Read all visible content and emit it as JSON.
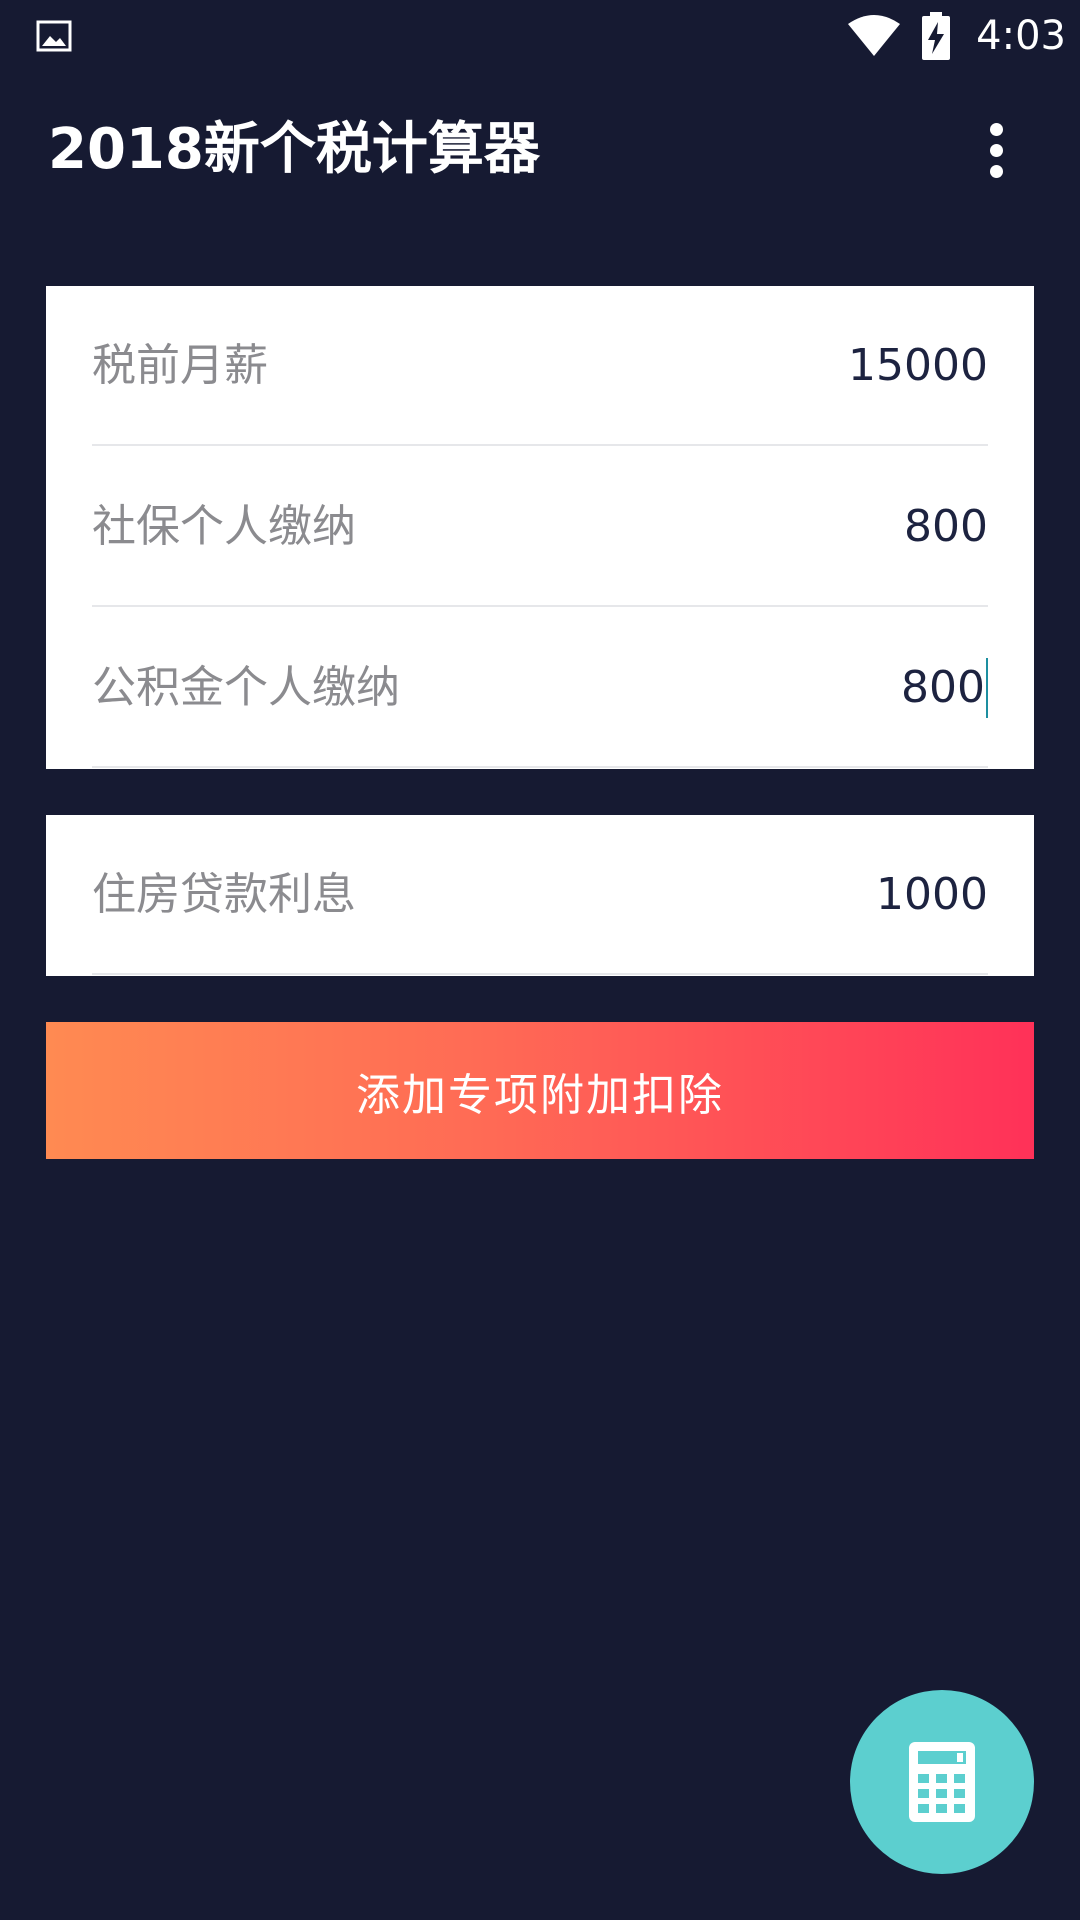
{
  "status_bar": {
    "time": "4:03",
    "left_icon": "gallery-icon",
    "icons": [
      "wifi-icon",
      "battery-charging-icon"
    ]
  },
  "app_bar": {
    "title": "2018新个税计算器",
    "menu_icon": "more-vert-icon"
  },
  "main_card": {
    "rows": [
      {
        "label": "税前月薪",
        "value": "15000"
      },
      {
        "label": "社保个人缴纳",
        "value": "800"
      },
      {
        "label": "公积金个人缴纳",
        "value": "800"
      }
    ]
  },
  "extra_card": {
    "rows": [
      {
        "label": "住房贷款利息",
        "value": "1000"
      }
    ]
  },
  "add_deduction_button": {
    "label": "添加专项附加扣除"
  },
  "fab": {
    "icon": "calculator-icon"
  },
  "colors": {
    "background": "#161a32",
    "card": "#ffffff",
    "label_text": "#8b8b8f",
    "value_text": "#1d2340",
    "button_gradient_start": "#ff8a52",
    "button_gradient_end": "#ff3158",
    "fab": "#5ccfcf"
  }
}
